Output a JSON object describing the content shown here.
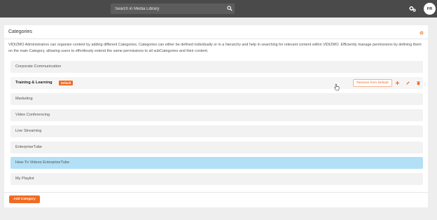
{
  "header": {
    "search_placeholder": "Search in Media Library",
    "avatar_initials": "FR"
  },
  "panel": {
    "title": "Categories",
    "description": "VIDIZMO Administrators can organize content by adding different Categories. Categories can either be defined individually or in a hierarchy and help in searching for relevant content within VIDIZMO. Efficiently manage permissions by defining them on the main Category, allowing users to effortlessly extend the same permissions to all subCategories and their content."
  },
  "categories": [
    {
      "label": "Corporate Communication"
    },
    {
      "label": "Training & Learning",
      "badge": "Default",
      "remove_default_label": "Remove from Default"
    },
    {
      "label": "Marketing"
    },
    {
      "label": "Video Conferencing"
    },
    {
      "label": "Live Streaming"
    },
    {
      "label": "EnterpriseTube"
    },
    {
      "label": "How-To Videos EnterpriseTube"
    },
    {
      "label": "My Playlist"
    }
  ],
  "footer": {
    "add_category_label": "Add Category"
  },
  "colors": {
    "accent": "#f26b21",
    "topbar": "#4a4a4a",
    "highlight": "#b3e0f6"
  }
}
